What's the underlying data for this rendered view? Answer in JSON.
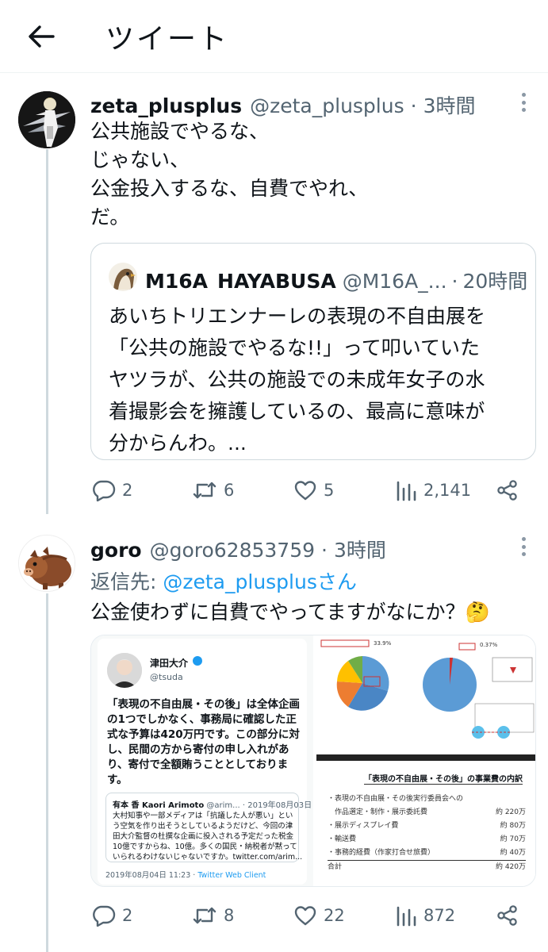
{
  "header": {
    "title": "ツイート"
  },
  "tweet1": {
    "display_name": "zeta_plusplus",
    "handle": "@zeta_plusplus",
    "dot": "·",
    "time": "3時間",
    "lines": [
      "公共施設でやるな、",
      "じゃない、",
      "公金投入するな、自費でやれ、",
      "だ。"
    ],
    "quote": {
      "name_part1": "M16A",
      "name_part2": "HAYABUSA",
      "handle": "@M16A_...",
      "dot": "·",
      "time": "20時間",
      "lines": [
        "あいちトリエンナーレの表現の不自由展を",
        "「公共の施設でやるな!!」って叩いていた",
        "ヤツラが、公共の施設での未成年女子の水",
        "着撮影会を擁護しているの、最高に意味が",
        "分からんわ。..."
      ]
    },
    "actions": {
      "replies": "2",
      "retweets": "6",
      "likes": "5",
      "views": "2,141"
    }
  },
  "tweet2": {
    "display_name": "goro",
    "handle": "@goro62853759",
    "dot": "·",
    "time": "3時間",
    "reply_prefix": "返信先: ",
    "reply_target": "@zeta_plusplusさん",
    "text": "公金使わずに自費でやってますがなにか？🤔",
    "media": {
      "embed": {
        "name": "津田大介",
        "handle": "@tsuda",
        "body": [
          "「表現の不自由展・その後」は全体企画",
          "の1つでしかなく、事務局に確認した正",
          "式な予算は420万円です。この部分に対",
          "し、民間の方から寄付の申し入れがあ",
          "り、寄付で全額賄うこととしておりま",
          "す。"
        ],
        "quote_name": "有本 香 Kaori Arimoto",
        "quote_meta": "@arim... · 2019年08月03日",
        "quote_body": [
          "大村知事や一部メディアは「抗議した人が悪い」とい",
          "う空気を作り出そうとしているようだけど、今回の津",
          "田大介監督の杜撰な企画に投入される予定だった税金",
          "10億ですからね、10億。多くの国民・納税者が黙って",
          "いられるわけないじゃないですか。twitter.com/arim..."
        ],
        "footer_date": "2019年08月04日 11:23 · ",
        "footer_client": "Twitter Web Client"
      },
      "cost_table": {
        "title": "「表現の不自由展・その後」の事業費の内訳",
        "rows": [
          {
            "label": "・表現の不自由展・その後実行委員会への",
            "amount": ""
          },
          {
            "label": "　作品選定・制作・展示委託費",
            "amount": "約 220万"
          },
          {
            "label": "・展示ディスプレイ費",
            "amount": "約 80万"
          },
          {
            "label": "・輸送費",
            "amount": "約 70万"
          },
          {
            "label": "・事務的経費（作家打合せ旅費）",
            "amount": "約 40万"
          }
        ],
        "total_label": "合計",
        "total_amount": "約 420万"
      },
      "pie_chart": {
        "label_left": "33.9%",
        "label_right": "0.37%"
      }
    },
    "actions": {
      "replies": "2",
      "retweets": "8",
      "likes": "22",
      "views": "872"
    }
  },
  "colors": {
    "accent": "#1d9bf0",
    "muted": "#536471",
    "border": "#cfd9de",
    "text": "#0f1419"
  },
  "icons": [
    "back-arrow-icon",
    "more-icon",
    "reply-icon",
    "retweet-icon",
    "like-icon",
    "views-icon",
    "share-icon",
    "thinking-face-emoji"
  ]
}
